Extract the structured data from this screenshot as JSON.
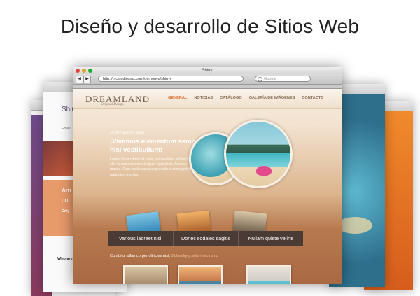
{
  "headline": "Diseño y desarrollo de Sitios Web",
  "back_windows": {
    "left_title": "Shin",
    "left_email": "Email:",
    "left_orange_text": "Am",
    "left_orange_text2": "co",
    "left_orange_link": "Only",
    "left_bottom_text": "Who are"
  },
  "browser": {
    "window_title": "Shiny",
    "url": "http://mcstudiosmx.com/demo/wp/shiny/",
    "search_placeholder": "Google",
    "back_symbol": "◀",
    "forward_symbol": "▶"
  },
  "site": {
    "logo": "DREAMLAND",
    "logo_tagline": "Original Design",
    "menu": [
      "GENERAL",
      "NOTICIAS",
      "CATÁLOGO",
      "GALERÍA DE IMÁGENES",
      "CONTACTO"
    ],
    "hero": {
      "kicker": "Lorem ipsum dolor",
      "title": "¡Vivamus elementum semper nisi vestibullum!",
      "text": "Lorem ipsum dolor sit amet, consectetur adipiscing elit. Aenean commodo ligula eget dolor. Aenean massa. Cum sociis natoque penatibus et magnis dis parturient montes."
    },
    "feature_bar": [
      "Various laoreet nisil",
      "Donec sodales sagitis",
      "Nullam quiste velirte"
    ],
    "intro_text": "Curabitur ullamcorper ultricies nisi,",
    "intro_highlight": "5 blandryty sella invictrumo"
  },
  "colors": {
    "accent": "#d6702d",
    "bar": "#4a3b34"
  }
}
